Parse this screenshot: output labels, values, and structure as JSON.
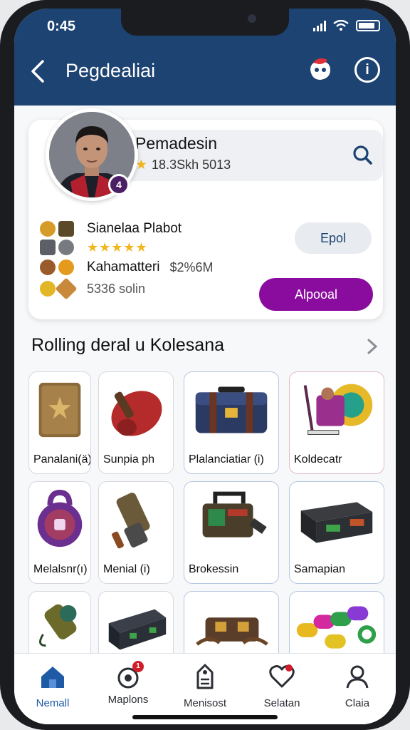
{
  "status_bar": {
    "time": "0:45"
  },
  "header": {
    "title": "Pegdealiai",
    "info_glyph": "i"
  },
  "profile": {
    "name": "Pemadesin",
    "rating_text": "18.3Skh 5013",
    "badge_glyph": "4",
    "rows": [
      {
        "title": "Sianelaa Plabot"
      },
      {
        "stars": "★★★★★"
      },
      {
        "title": "Kahamatteri",
        "price": "$2%6M"
      },
      {
        "sub": "5336 solin"
      }
    ],
    "secondary_button": "Epol",
    "primary_button": "Alpooal"
  },
  "section": {
    "title": "Rolling deral u Kolesana"
  },
  "items": [
    {
      "label": "Panalani(ä)"
    },
    {
      "label": "Sunpia ph"
    },
    {
      "label": "Plalanciatiar (i)"
    },
    {
      "label": "Koldecatr"
    },
    {
      "label": "Melalsnr(ı)"
    },
    {
      "label": "Menial (i)"
    },
    {
      "label": "Brokessin"
    },
    {
      "label": "Samapian"
    },
    {
      "label": ""
    },
    {
      "label": ""
    },
    {
      "label": ""
    },
    {
      "label": ""
    }
  ],
  "bottom_nav": [
    {
      "label": "Nemall",
      "icon": "home-icon",
      "active": true
    },
    {
      "label": "Maplons",
      "icon": "notification-icon",
      "badge": "1"
    },
    {
      "label": "Menisost",
      "icon": "price-tag-icon"
    },
    {
      "label": "Selatan",
      "icon": "heart-icon"
    },
    {
      "label": "Claia",
      "icon": "profile-icon"
    }
  ],
  "colors": {
    "header": "#1c4371",
    "accent_purple": "#8a0c9e",
    "active_tab": "#1f5aa6"
  }
}
